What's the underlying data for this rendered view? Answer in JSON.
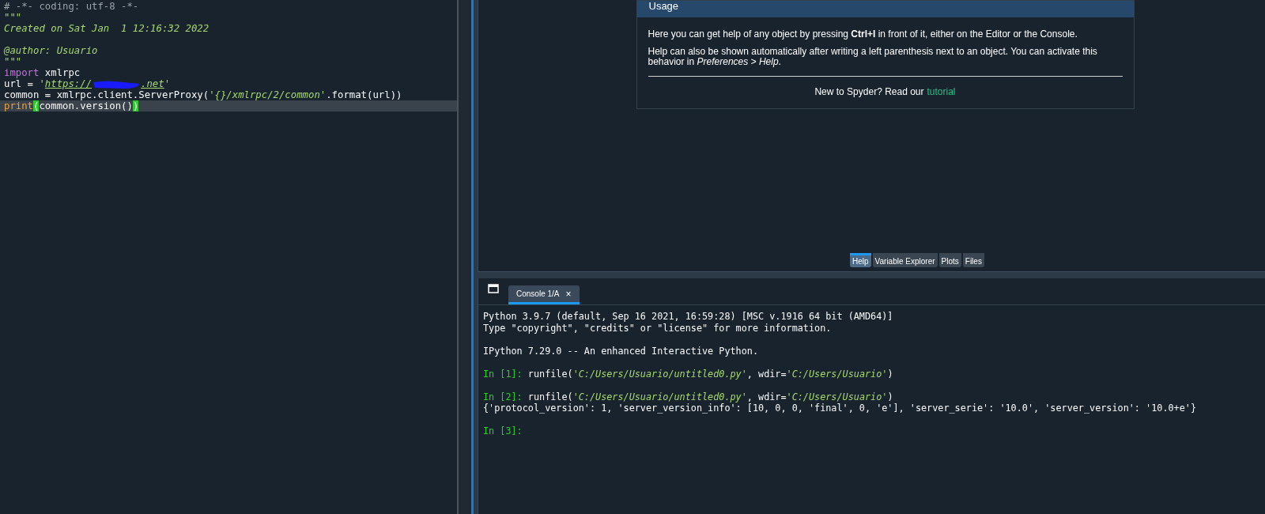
{
  "editor": {
    "lines": [
      {
        "kind": "code",
        "current": false,
        "tokens": [
          {
            "kind": "comment",
            "text": "# -*- coding: utf-8 -*-"
          }
        ]
      },
      {
        "kind": "code",
        "current": false,
        "tokens": [
          {
            "kind": "docstring",
            "text": "\"\"\""
          }
        ]
      },
      {
        "kind": "code",
        "current": false,
        "tokens": [
          {
            "kind": "docstring",
            "text": "Created on Sat Jan  1 12:16:32 2022"
          }
        ]
      },
      {
        "kind": "blank",
        "current": false
      },
      {
        "kind": "code",
        "current": false,
        "tokens": [
          {
            "kind": "docstring",
            "text": "@author: Usuario"
          }
        ]
      },
      {
        "kind": "code",
        "current": false,
        "tokens": [
          {
            "kind": "docstring",
            "text": "\"\"\""
          }
        ]
      },
      {
        "kind": "code",
        "current": false,
        "tokens": [
          {
            "kind": "keyword",
            "text": "import"
          },
          {
            "kind": "plain",
            "text": " xmlrpc"
          }
        ]
      },
      {
        "kind": "code",
        "current": false,
        "tokens": [
          {
            "kind": "plain",
            "text": "url = "
          },
          {
            "kind": "string",
            "text": "'"
          },
          {
            "kind": "link",
            "text": "https://"
          },
          {
            "kind": "redaction"
          },
          {
            "kind": "link",
            "text": ".net"
          },
          {
            "kind": "string",
            "text": "'"
          }
        ]
      },
      {
        "kind": "code",
        "current": false,
        "tokens": [
          {
            "kind": "plain",
            "text": "common = xmlrpc.client.ServerProxy("
          },
          {
            "kind": "string",
            "text": "'{}/xmlrpc/2/common'"
          },
          {
            "kind": "plain",
            "text": ".format(url))"
          }
        ]
      },
      {
        "kind": "code",
        "current": true,
        "tokens": [
          {
            "kind": "builtin",
            "text": "print"
          },
          {
            "kind": "match",
            "text": "("
          },
          {
            "kind": "plain",
            "text": "common.version()"
          },
          {
            "kind": "match",
            "text": ")"
          }
        ]
      }
    ]
  },
  "help": {
    "title": "Usage",
    "paragraphs": [
      "Here you can get help of any object by pressing **Ctrl+I** in front of it, either on the Editor or the Console.",
      "Help can also be shown automatically after writing a left parenthesis next to an object. You can activate this behavior in *Preferences > Help*."
    ],
    "footer": "New to Spyder? Read our",
    "link": "tutorial"
  },
  "pane_tabs": [
    {
      "label": "Help",
      "selected": true
    },
    {
      "label": "Variable Explorer",
      "selected": false
    },
    {
      "label": "Plots",
      "selected": false
    },
    {
      "label": "Files",
      "selected": false
    }
  ],
  "console": {
    "tab": {
      "label": "Console 1/A",
      "close": "×",
      "selected": true
    },
    "lines": [
      {
        "kind": "output",
        "tokens": [
          {
            "kind": "plain",
            "text": "Python 3.9.7 (default, Sep 16 2021, 16:59:28) [MSC v.1916 64 bit (AMD64)]"
          }
        ]
      },
      {
        "kind": "output",
        "tokens": [
          {
            "kind": "plain",
            "text": "Type \"copyright\", \"credits\" or \"license\" for more information."
          }
        ]
      },
      {
        "kind": "blank"
      },
      {
        "kind": "output",
        "tokens": [
          {
            "kind": "plain",
            "text": "IPython 7.29.0 -- An enhanced Interactive Python."
          }
        ]
      },
      {
        "kind": "blank"
      },
      {
        "kind": "output",
        "tokens": [
          {
            "kind": "prompt",
            "text": "In [1]:"
          },
          {
            "kind": "plain",
            "text": " runfile("
          },
          {
            "kind": "string",
            "text": "'C:/Users/Usuario/untitled0.py'"
          },
          {
            "kind": "plain",
            "text": ", wdir="
          },
          {
            "kind": "string",
            "text": "'C:/Users/Usuario'"
          },
          {
            "kind": "plain",
            "text": ")"
          }
        ]
      },
      {
        "kind": "blank"
      },
      {
        "kind": "output",
        "tokens": [
          {
            "kind": "prompt",
            "text": "In [2]:"
          },
          {
            "kind": "plain",
            "text": " runfile("
          },
          {
            "kind": "string",
            "text": "'C:/Users/Usuario/untitled0.py'"
          },
          {
            "kind": "plain",
            "text": ", wdir="
          },
          {
            "kind": "string",
            "text": "'C:/Users/Usuario'"
          },
          {
            "kind": "plain",
            "text": ")"
          }
        ]
      },
      {
        "kind": "output",
        "tokens": [
          {
            "kind": "plain",
            "text": "{'protocol_version': 1, 'server_version_info': [10, 0, 0, 'final', 0, 'e'], 'server_serie': '10.0', 'server_version': '10.0+e'}"
          }
        ]
      },
      {
        "kind": "blank"
      },
      {
        "kind": "output",
        "tokens": [
          {
            "kind": "prompt",
            "text": "In [3]:"
          }
        ]
      }
    ]
  }
}
